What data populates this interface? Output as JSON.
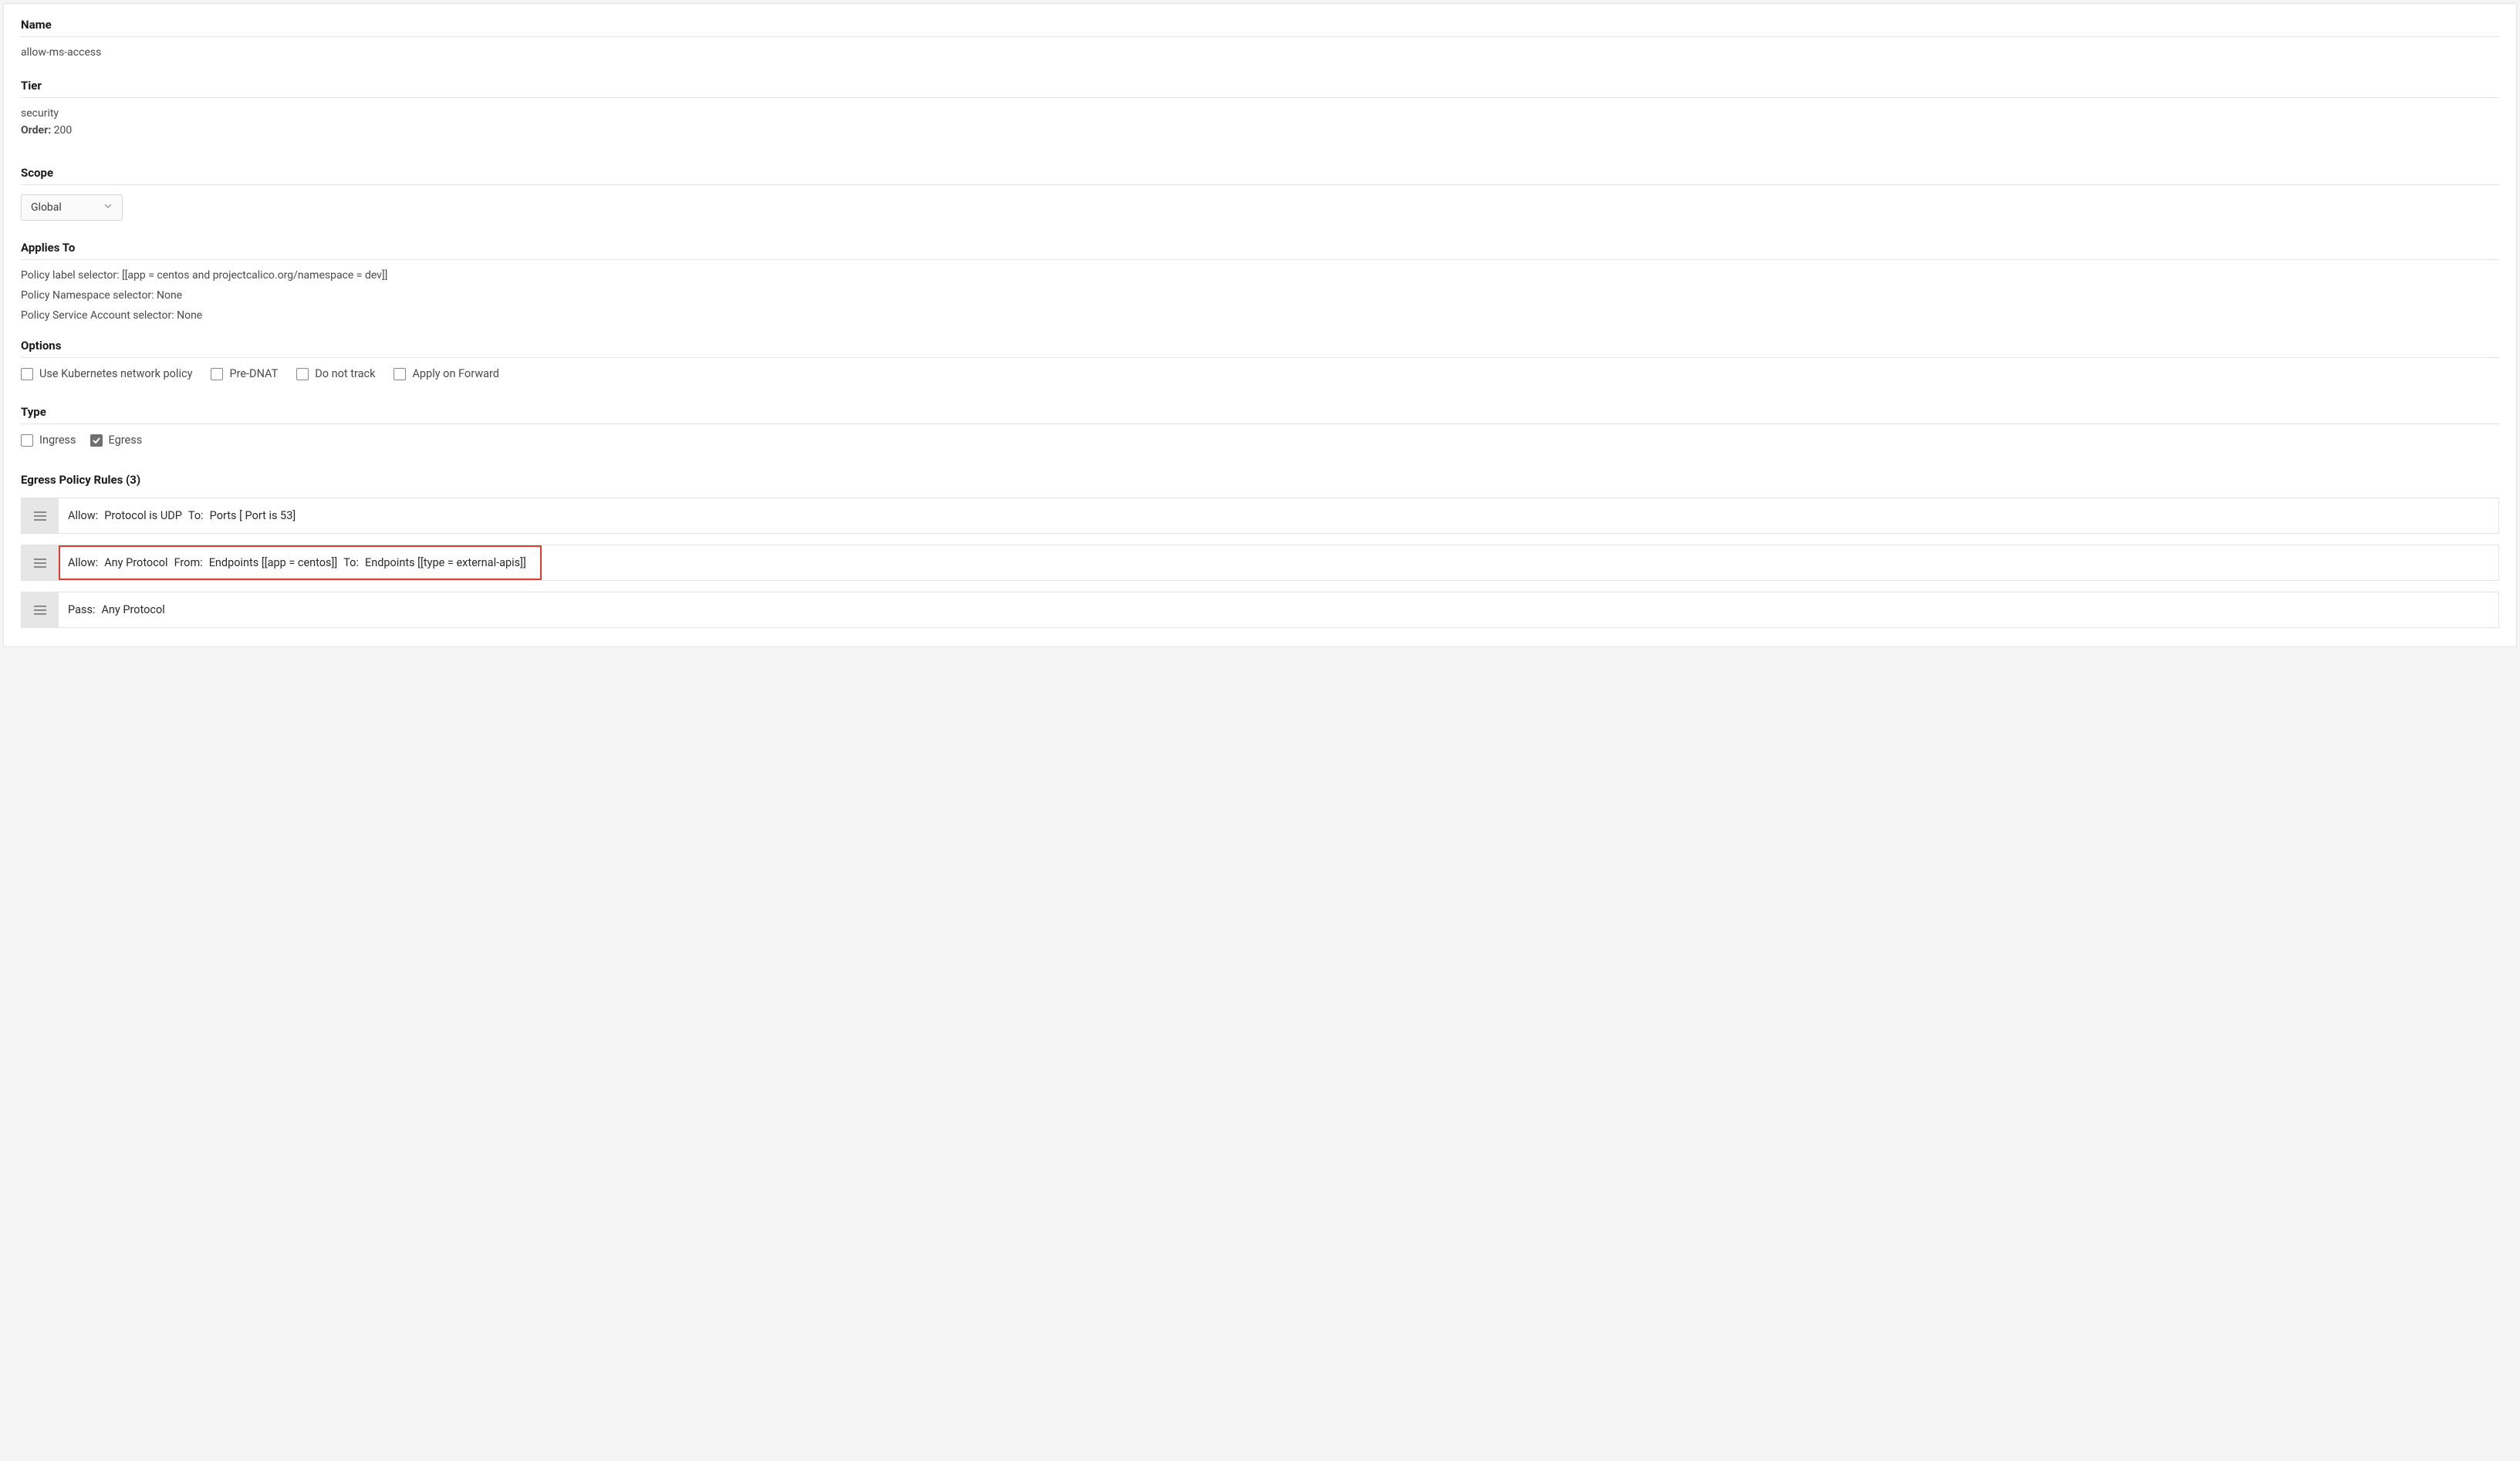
{
  "name": {
    "label": "Name",
    "value": "allow-ms-access"
  },
  "tier": {
    "label": "Tier",
    "value": "security",
    "order_label": "Order:",
    "order_value": "200"
  },
  "scope": {
    "label": "Scope",
    "selected": "Global"
  },
  "applies": {
    "label": "Applies To",
    "label_selector": "Policy label selector: [[app = centos and projectcalico.org/namespace = dev]]",
    "namespace_selector": "Policy Namespace selector: None",
    "service_account_selector": "Policy Service Account selector: None"
  },
  "options": {
    "label": "Options",
    "items": [
      {
        "label": "Use Kubernetes network policy",
        "checked": false
      },
      {
        "label": "Pre-DNAT",
        "checked": false
      },
      {
        "label": "Do not track",
        "checked": false
      },
      {
        "label": "Apply on Forward",
        "checked": false
      }
    ]
  },
  "type": {
    "label": "Type",
    "items": [
      {
        "label": "Ingress",
        "checked": false
      },
      {
        "label": "Egress",
        "checked": true
      }
    ]
  },
  "rules": {
    "label": "Egress Policy Rules (3)",
    "items": [
      {
        "action": "Allow:",
        "protocol": "Protocol is UDP",
        "to_label": "To:",
        "to_value": "Ports [ Port is 53]",
        "highlighted": false
      },
      {
        "action": "Allow:",
        "protocol": "Any Protocol",
        "from_label": "From:",
        "from_value": "Endpoints [[app = centos]]",
        "to_label": "To:",
        "to_value": "Endpoints [[type = external-apis]]",
        "highlighted": true
      },
      {
        "action": "Pass:",
        "protocol": "Any Protocol",
        "highlighted": false
      }
    ]
  }
}
